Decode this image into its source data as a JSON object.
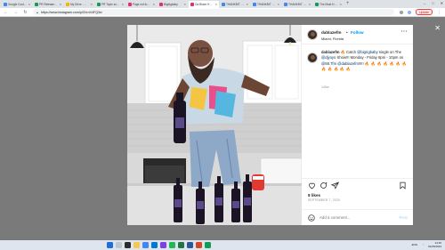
{
  "browser": {
    "tabs": [
      {
        "label": "Google Custom...",
        "color": "#4285f4"
      },
      {
        "label": "PR Release In...",
        "color": "#0f9d58"
      },
      {
        "label": "My Drive - Goo...",
        "color": "#f4b400"
      },
      {
        "label": "PR Topic so...",
        "color": "#0f9d58"
      },
      {
        "label": "Page not found",
        "color": "#e1306c"
      },
      {
        "label": "Bigbigbaby",
        "color": "#e1306c"
      },
      {
        "label": "Ga Blaze Hoo...",
        "color": "#e1306c"
      },
      {
        "label": "THANKBIT 2023",
        "color": "#4285f4"
      },
      {
        "label": "THANKBIT 2023",
        "color": "#4285f4"
      },
      {
        "label": "THANKBIT 2023",
        "color": "#4285f4"
      },
      {
        "label": "The Most Havi...",
        "color": "#0f9d58"
      }
    ],
    "active_tab_index": 6,
    "url": "https://www.instagram.com/p/ChrnX4FQ3s/",
    "update_label": "Update"
  },
  "post": {
    "username": "dablazefm",
    "follow_label": "Follow",
    "location": "Miami, Florida",
    "caption_user": "dablazefm",
    "caption_parts": {
      "fire": "🔥",
      "p1": " Catch ",
      "mention1": "@bigrigbaby",
      "p2": " single on The ",
      "mention2": "@djyoyo",
      "p3": " Show!!! Monday - Friday 8pm - 10pm on ",
      "mention3": "@88.7fm",
      "p4": " ",
      "mention4": "@dablazefm",
      "p5": "!!!!! ",
      "emoji_row": "🔥 🔥 🔥 🔥 🔥 🔥 🔥 🔥 🔥 🔥 🔥 🔥"
    },
    "caption_time": "140w",
    "likes": "8 likes",
    "date": "SEPTEMBER 7, 2020",
    "comment_placeholder": "Add a comment...",
    "post_label": "Post"
  },
  "taskbar": {
    "time": "14:30",
    "date": "01/06/2023",
    "lang": "ENG"
  }
}
